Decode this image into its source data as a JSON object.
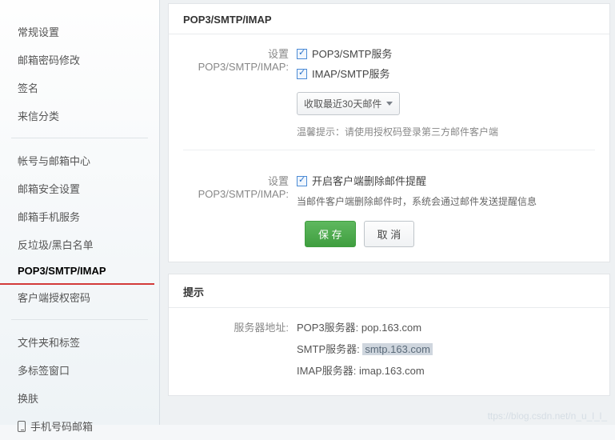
{
  "sidebar": {
    "group1": [
      "常规设置",
      "邮箱密码修改",
      "签名",
      "来信分类"
    ],
    "group2": [
      "帐号与邮箱中心",
      "邮箱安全设置",
      "邮箱手机服务",
      "反垃圾/黑白名单",
      "POP3/SMTP/IMAP",
      "客户端授权密码"
    ],
    "group3": [
      "文件夹和标签",
      "多标签窗口",
      "换肤",
      "手机号码邮箱"
    ],
    "activeIndex": 4
  },
  "panel1": {
    "title": "POP3/SMTP/IMAP",
    "set_label": "设置POP3/SMTP/IMAP:",
    "opt_pop3": "POP3/SMTP服务",
    "opt_imap": "IMAP/SMTP服务",
    "fetch_label": "收取最近30天邮件",
    "hint": "温馨提示：请使用授权码登录第三方邮件客户端",
    "opt_delnotice": "开启客户端删除邮件提醒",
    "desc": "当邮件客户端删除邮件时，系统会通过邮件发送提醒信息",
    "save": "保 存",
    "cancel": "取 消"
  },
  "panel2": {
    "title": "提示",
    "label": "服务器地址:",
    "pop3": "POP3服务器: pop.163.com",
    "smtp_l": "SMTP服务器: ",
    "smtp_v": "smtp.163.com",
    "imap": "IMAP服务器: imap.163.com"
  },
  "watermark": "ttps://blog.csdn.net/n_u_l_l_"
}
